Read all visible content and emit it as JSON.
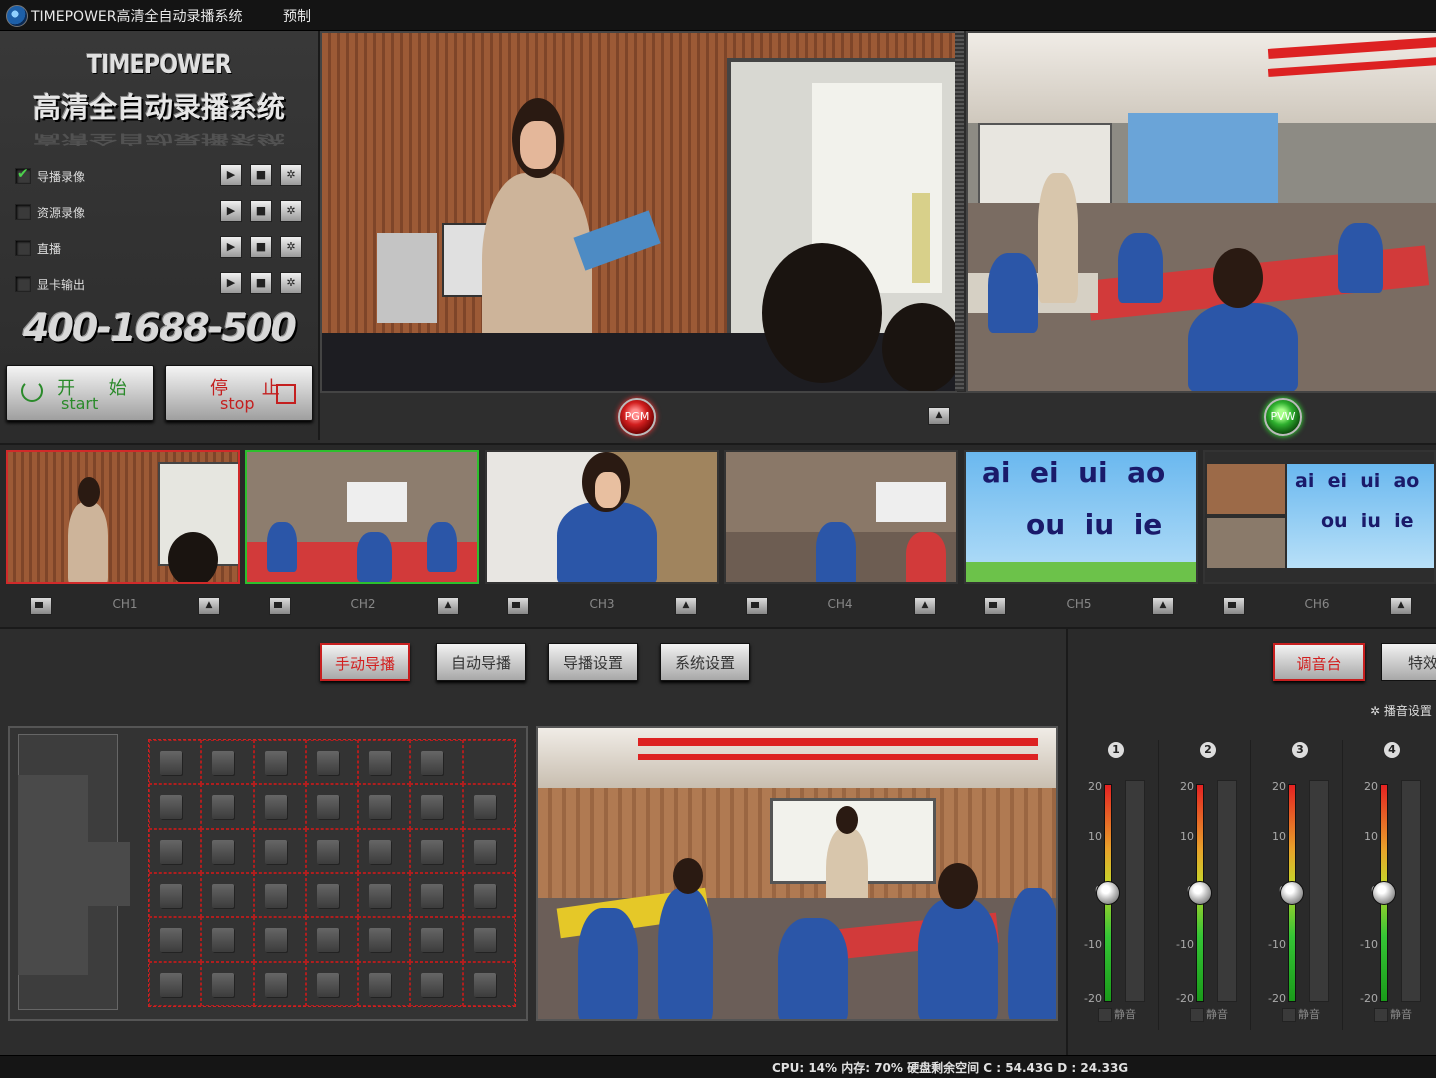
{
  "window": {
    "title": "TIMEPOWER高清全自动录播系统",
    "menu": [
      "预制"
    ]
  },
  "brand": {
    "name": "TIMEPOWER",
    "subtitle": "高清全自动录播系统",
    "hotline": "400-1688-500"
  },
  "record_rows": [
    {
      "label": "导播录像",
      "checked": true
    },
    {
      "label": "资源录像",
      "checked": false
    },
    {
      "label": "直播",
      "checked": false
    },
    {
      "label": "显卡输出",
      "checked": false
    }
  ],
  "row_icons": [
    "play-icon",
    "stop-icon",
    "gear-icon"
  ],
  "start_button": {
    "cn": "开 始",
    "en": "start"
  },
  "stop_button": {
    "cn": "停 止",
    "en": "stop"
  },
  "monitors": {
    "pgm_label": "PGM",
    "pvw_label": "PVW"
  },
  "channels": [
    {
      "label": "CH1",
      "state": "pgm"
    },
    {
      "label": "CH2",
      "state": "pvw"
    },
    {
      "label": "CH3",
      "state": ""
    },
    {
      "label": "CH4",
      "state": ""
    },
    {
      "label": "CH5",
      "state": ""
    },
    {
      "label": "CH6",
      "state": ""
    }
  ],
  "pinyin": {
    "row1": "ai  ei  ui  ao",
    "row2": "ou  iu  ie"
  },
  "tabs": [
    {
      "label": "手动导播",
      "active": true
    },
    {
      "label": "自动导播",
      "active": false
    },
    {
      "label": "导播设置",
      "active": false
    },
    {
      "label": "系统设置",
      "active": false
    }
  ],
  "audio_tabs": [
    {
      "label": "调音台",
      "active": true
    },
    {
      "label": "特效",
      "active": false
    }
  ],
  "audio_settings_label": "播音设置",
  "mixer": {
    "scale": [
      "20",
      "10",
      "0",
      "-10",
      "-20"
    ],
    "mute_label": "静音",
    "channels": [
      {
        "num": "1",
        "level_db": 0
      },
      {
        "num": "2",
        "level_db": 0
      },
      {
        "num": "3",
        "level_db": 0
      },
      {
        "num": "4",
        "level_db": 0
      }
    ]
  },
  "status": {
    "text": "CPU: 14% 内存: 70% 硬盘剩余空间  C : 54.43G D : 24.33G"
  },
  "colors": {
    "pgm": "#d12a2a",
    "pvw": "#2dbf2d",
    "background": "#2b2b2b"
  }
}
